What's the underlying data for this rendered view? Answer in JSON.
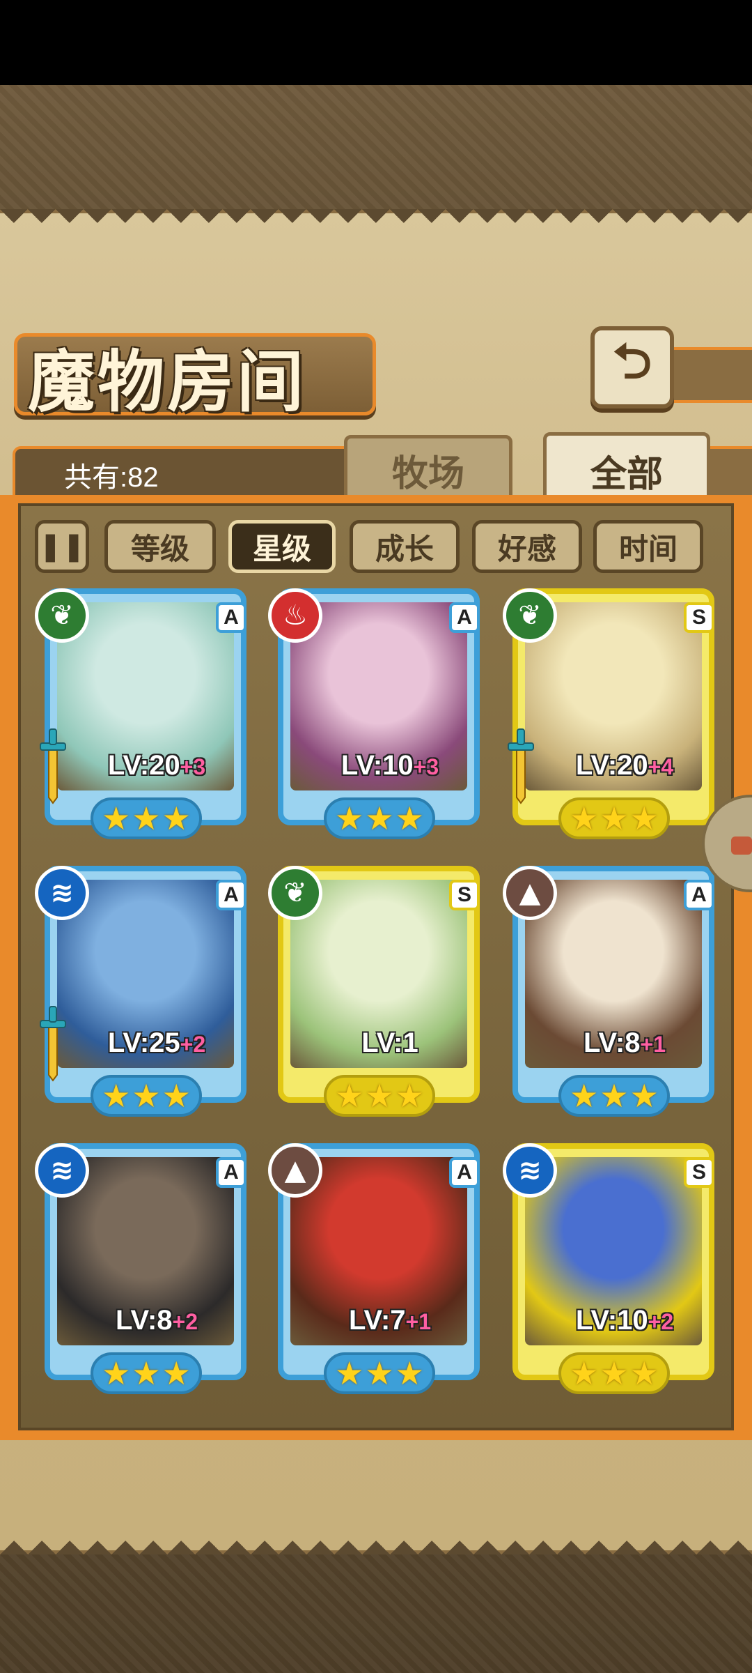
{
  "header": {
    "title": "魔物房间",
    "back_icon": "return-arrow-icon"
  },
  "summary": {
    "count_label": "共有:82"
  },
  "tabs": [
    {
      "label": "牧场",
      "active": false
    },
    {
      "label": "全部",
      "active": true
    }
  ],
  "filters": {
    "sort_icon": "pause-sort-icon",
    "items": [
      {
        "label": "等级",
        "active": false
      },
      {
        "label": "星级",
        "active": true
      },
      {
        "label": "成长",
        "active": false
      },
      {
        "label": "好感",
        "active": false
      },
      {
        "label": "时间",
        "active": false
      }
    ]
  },
  "monsters": [
    {
      "element": "leaf",
      "rarity": "A",
      "level": "LV:20",
      "plus": "+3",
      "stars": 3,
      "frame": "blue",
      "has_weapon": true,
      "colors": [
        "#cfe9e2",
        "#8fc7b8"
      ]
    },
    {
      "element": "fire",
      "rarity": "A",
      "level": "LV:10",
      "plus": "+3",
      "stars": 3,
      "frame": "blue",
      "has_weapon": false,
      "colors": [
        "#e9c3d8",
        "#8a4a7a"
      ]
    },
    {
      "element": "leaf",
      "rarity": "S",
      "level": "LV:20",
      "plus": "+4",
      "stars": 3,
      "frame": "gold",
      "has_weapon": true,
      "colors": [
        "#f2e7b9",
        "#c9b27a"
      ]
    },
    {
      "element": "water",
      "rarity": "A",
      "level": "LV:25",
      "plus": "+2",
      "stars": 3,
      "frame": "blue",
      "has_weapon": true,
      "colors": [
        "#7fb0e0",
        "#2f5d9a"
      ]
    },
    {
      "element": "leaf",
      "rarity": "S",
      "level": "LV:1",
      "plus": "",
      "stars": 3,
      "frame": "gold",
      "has_weapon": false,
      "colors": [
        "#e7f0cf",
        "#9cc37a"
      ]
    },
    {
      "element": "earth",
      "rarity": "A",
      "level": "LV:8",
      "plus": "+1",
      "stars": 3,
      "frame": "blue",
      "has_weapon": false,
      "colors": [
        "#efe3cf",
        "#6b4a34"
      ]
    },
    {
      "element": "water",
      "rarity": "A",
      "level": "LV:8",
      "plus": "+2",
      "stars": 3,
      "frame": "blue",
      "has_weapon": false,
      "colors": [
        "#7a6a5a",
        "#2c2a2a"
      ]
    },
    {
      "element": "earth",
      "rarity": "A",
      "level": "LV:7",
      "plus": "+1",
      "stars": 3,
      "frame": "blue",
      "has_weapon": false,
      "colors": [
        "#d23a2e",
        "#5a2a1a"
      ]
    },
    {
      "element": "water",
      "rarity": "S",
      "level": "LV:10",
      "plus": "+2",
      "stars": 3,
      "frame": "gold",
      "has_weapon": false,
      "colors": [
        "#4a6fd0",
        "#e2c815"
      ]
    }
  ]
}
